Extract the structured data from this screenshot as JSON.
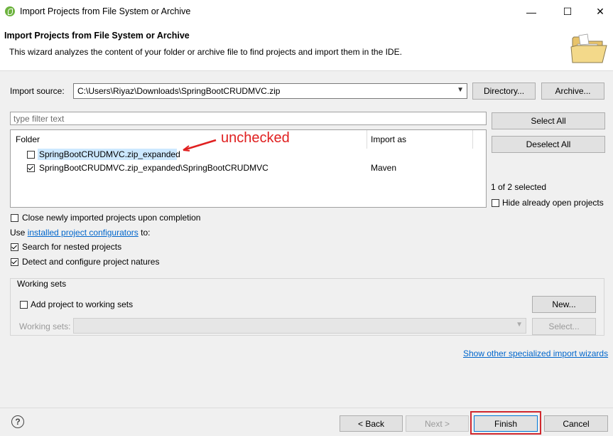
{
  "window": {
    "title": "Import Projects from File System or Archive",
    "minimize": "—",
    "maximize": "☐",
    "close": "✕"
  },
  "header": {
    "title": "Import Projects from File System or Archive",
    "description": "This wizard analyzes the content of your folder or archive file to find projects and import them in the IDE.",
    "icon": "folder-icon"
  },
  "import_source": {
    "label": "Import source:",
    "value": "C:\\Users\\Riyaz\\Downloads\\SpringBootCRUDMVC.zip",
    "directory_button": "Directory...",
    "archive_button": "Archive..."
  },
  "filter": {
    "placeholder": "type filter text"
  },
  "table": {
    "columns": [
      "Folder",
      "Import as"
    ],
    "rows": [
      {
        "folder": "SpringBootCRUDMVC.zip_expanded",
        "import_as": "",
        "checked": false,
        "selected": true
      },
      {
        "folder": "SpringBootCRUDMVC.zip_expanded\\SpringBootCRUDMVC",
        "import_as": "Maven",
        "checked": true,
        "selected": false
      }
    ]
  },
  "annotation": {
    "text": "unchecked",
    "color": "#e02020"
  },
  "side": {
    "select_all": "Select All",
    "deselect_all": "Deselect All",
    "selection_count": "1 of 2 selected",
    "hide_open": "Hide already open projects"
  },
  "options": {
    "close_imported": "Close newly imported projects upon completion",
    "use_prefix": "Use ",
    "configurators_link": "installed project configurators",
    "use_suffix": " to:",
    "search_nested": "Search for nested projects",
    "detect_natures": "Detect and configure project natures"
  },
  "working_sets": {
    "group_label": "Working sets",
    "add_label": "Add project to working sets",
    "new_button": "New...",
    "sets_label": "Working sets:",
    "select_button": "Select..."
  },
  "show_wizards_link": "Show other specialized import wizards",
  "footer": {
    "help": "?",
    "back": "< Back",
    "next": "Next >",
    "finish": "Finish",
    "cancel": "Cancel",
    "highlight_color": "#d0282e"
  }
}
